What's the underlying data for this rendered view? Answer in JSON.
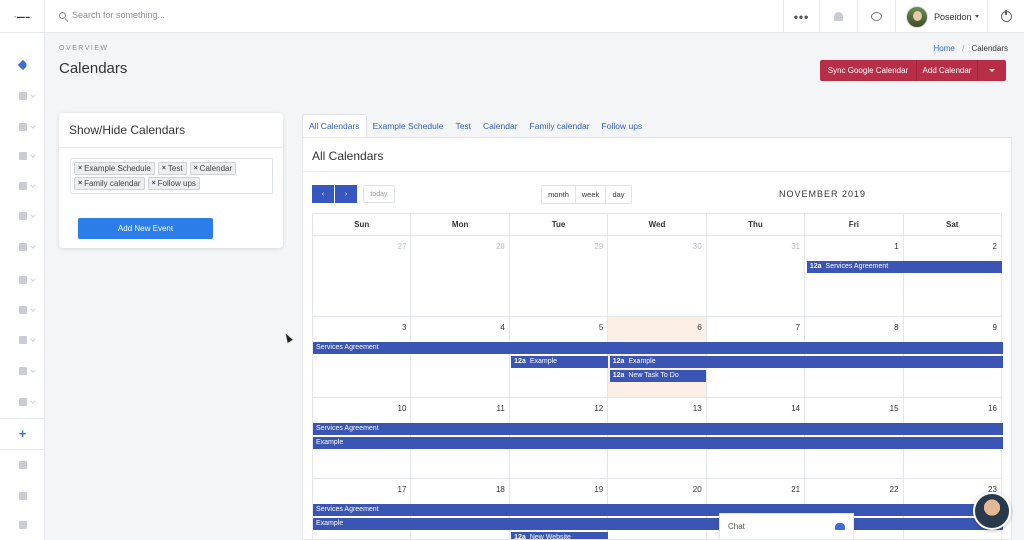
{
  "sidebar": {
    "logo": "OVERVIEW",
    "items": [
      {
        "icon": "paper-plane-icon",
        "active": true
      },
      {
        "icon": "user-icon"
      },
      {
        "icon": "users-icon"
      },
      {
        "icon": "list-icon"
      },
      {
        "icon": "folder-icon"
      },
      {
        "icon": "check-square-icon"
      },
      {
        "icon": "envelope-icon"
      },
      {
        "icon": "clipboard-icon"
      },
      {
        "icon": "sitemap-icon"
      },
      {
        "icon": "copy-icon"
      },
      {
        "icon": "file-icon"
      },
      {
        "icon": "file-alt-icon"
      },
      {
        "icon": "plus-icon"
      },
      {
        "icon": "facebook-icon"
      },
      {
        "icon": "bullhorn-icon"
      },
      {
        "icon": "book-icon"
      }
    ]
  },
  "topbar": {
    "search_placeholder": "Search for something...",
    "user_name": "Poseidon"
  },
  "header": {
    "overview": "OVERVIEW",
    "title": "Calendars",
    "breadcrumb_home": "Home",
    "breadcrumb_sep": "/",
    "breadcrumb_current": "Calendars",
    "sync_button": "Sync Google Calendar",
    "add_button": "Add Calendar"
  },
  "show_hide": {
    "title": "Show/Hide Calendars",
    "tags": [
      "Example Schedule",
      "Test",
      "Calendar",
      "Family calendar",
      "Follow ups"
    ],
    "tag_remove": "×",
    "add_event_button": "Add New Event"
  },
  "tabs": [
    "All Calendars",
    "Example Schedule",
    "Test",
    "Calendar",
    "Family calendar",
    "Follow ups"
  ],
  "calendar": {
    "title": "All Calendars",
    "prev_label": "‹",
    "next_label": "›",
    "today_label": "today",
    "views": [
      "month",
      "week",
      "day"
    ],
    "month_title": "NOVEMBER 2019",
    "days_of_week": [
      "Sun",
      "Mon",
      "Tue",
      "Wed",
      "Thu",
      "Fri",
      "Sat"
    ],
    "weeks": [
      [
        {
          "n": "27",
          "other": true
        },
        {
          "n": "28",
          "other": true
        },
        {
          "n": "29",
          "other": true
        },
        {
          "n": "30",
          "other": true
        },
        {
          "n": "31",
          "other": true
        },
        {
          "n": "1"
        },
        {
          "n": "2"
        }
      ],
      [
        {
          "n": "3"
        },
        {
          "n": "4"
        },
        {
          "n": "5"
        },
        {
          "n": "6",
          "today": true
        },
        {
          "n": "7"
        },
        {
          "n": "8"
        },
        {
          "n": "9"
        }
      ],
      [
        {
          "n": "10"
        },
        {
          "n": "11"
        },
        {
          "n": "12"
        },
        {
          "n": "13"
        },
        {
          "n": "14"
        },
        {
          "n": "15"
        },
        {
          "n": "16"
        }
      ],
      [
        {
          "n": "17"
        },
        {
          "n": "18"
        },
        {
          "n": "19"
        },
        {
          "n": "20"
        },
        {
          "n": "21"
        },
        {
          "n": "22"
        },
        {
          "n": "23"
        }
      ]
    ],
    "events": [
      {
        "week": 0,
        "start": 5,
        "span": 2,
        "row": 0,
        "time": "12a",
        "title": "Services Agreement"
      },
      {
        "week": 1,
        "start": 0,
        "span": 7,
        "row": 0,
        "time": "",
        "title": "Services Agreement"
      },
      {
        "week": 1,
        "start": 2,
        "span": 1,
        "row": 1,
        "time": "12a",
        "title": "Example"
      },
      {
        "week": 1,
        "start": 3,
        "span": 4,
        "row": 1,
        "time": "12a",
        "title": "Example"
      },
      {
        "week": 1,
        "start": 3,
        "span": 1,
        "row": 2,
        "time": "12a",
        "title": "New Task To Do"
      },
      {
        "week": 2,
        "start": 0,
        "span": 7,
        "row": 0,
        "time": "",
        "title": "Services Agreement"
      },
      {
        "week": 2,
        "start": 0,
        "span": 7,
        "row": 1,
        "time": "",
        "title": "Example"
      },
      {
        "week": 3,
        "start": 0,
        "span": 7,
        "row": 0,
        "time": "",
        "title": "Services Agreement"
      },
      {
        "week": 3,
        "start": 0,
        "span": 7,
        "row": 1,
        "time": "",
        "title": "Example"
      },
      {
        "week": 3,
        "start": 2,
        "span": 1,
        "row": 2,
        "time": "12a",
        "title": "New Website"
      }
    ]
  },
  "chat": {
    "label": "Chat"
  },
  "colors": {
    "event": "#3a55b4",
    "primary_button": "#2b7de9",
    "danger_button": "#b82e47",
    "today_highlight": "#fcefe6"
  }
}
